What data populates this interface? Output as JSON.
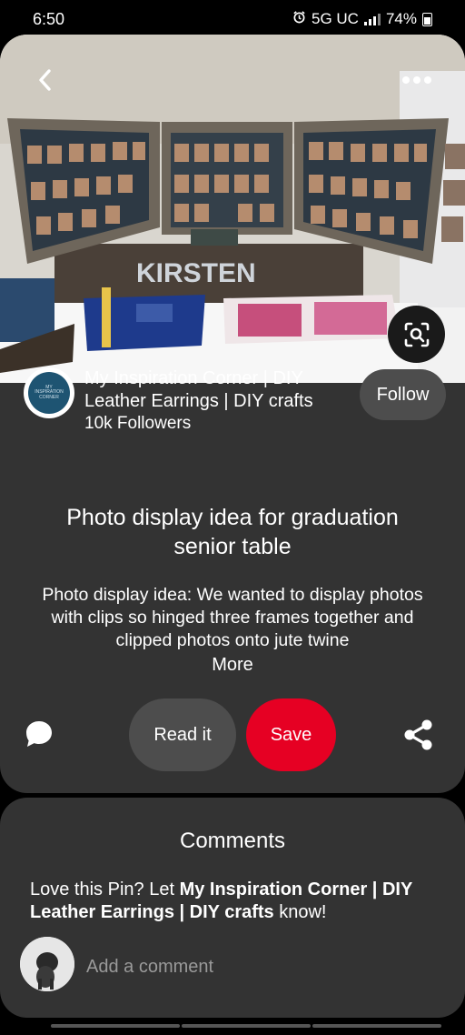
{
  "status_bar": {
    "time": "6:50",
    "network": "5G UC",
    "battery": "74%"
  },
  "pin": {
    "image_alt": "Hinged photo frames with clipped photos on a graduation table",
    "title": "Photo display idea for graduation senior table",
    "description": "Photo display idea: We wanted to display photos with clips so hinged three frames together and clipped photos onto jute twine",
    "more_label": "More"
  },
  "creator": {
    "name": "My Inspiration Corner | DIY Leather Earrings | DIY crafts",
    "followers": "10k Followers",
    "follow_label": "Follow"
  },
  "actions": {
    "read_label": "Read it",
    "save_label": "Save"
  },
  "comments": {
    "title": "Comments",
    "prompt_prefix": "Love this Pin? Let ",
    "prompt_name": "My Inspiration Corner | DIY Leather Earrings | DIY crafts",
    "prompt_suffix": " know!",
    "input_placeholder": "Add a comment"
  },
  "colors": {
    "save": "#e60023",
    "card": "#333333",
    "pill": "#4d4d4d"
  },
  "icons": [
    "back-icon",
    "more-options-icon",
    "visual-search-icon",
    "comment-icon",
    "share-icon",
    "signal-icon",
    "battery-icon",
    "alarm-icon"
  ]
}
